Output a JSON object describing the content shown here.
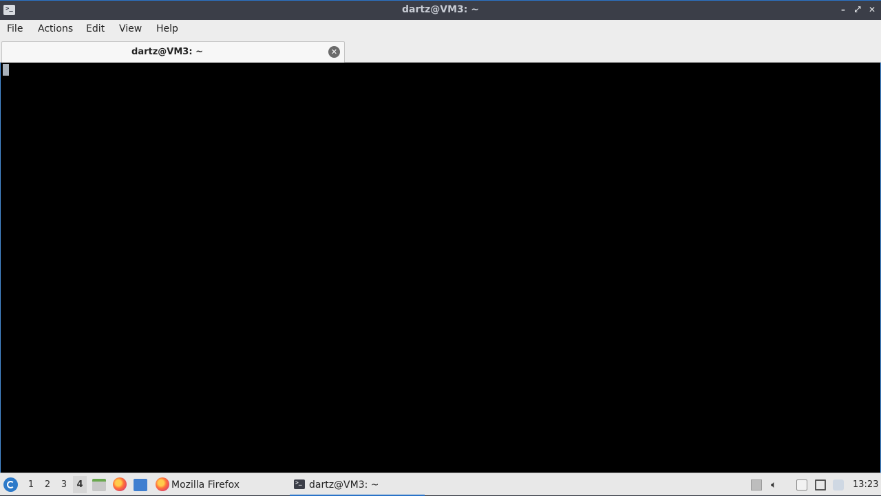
{
  "window": {
    "title": "dartz@VM3: ~",
    "icon": "terminal-icon",
    "controls": [
      "minimize-icon",
      "maximize-icon",
      "close-icon"
    ]
  },
  "menubar": {
    "items": [
      "File",
      "Actions",
      "Edit",
      "View",
      "Help"
    ]
  },
  "tabs": [
    {
      "label": "dartz@VM3: ~",
      "close_icon": "close-circle-icon"
    }
  ],
  "terminal": {
    "content": "",
    "background": "#000000",
    "cursor_color": "#a9b2bb"
  },
  "taskbar": {
    "start_icon": "lubuntu-start-icon",
    "workspaces": [
      "1",
      "2",
      "3",
      "4"
    ],
    "active_workspace": "4",
    "quicklaunch": [
      "file-manager-icon",
      "firefox-icon",
      "desktop-icon"
    ],
    "tasks": [
      {
        "label": "Mozilla Firefox",
        "icon": "firefox-icon",
        "active": false
      },
      {
        "label": "dartz@VM3: ~",
        "icon": "terminal-icon",
        "active": true
      }
    ],
    "tray": [
      "tray-arrow-icon",
      "volume-icon",
      "clipboard-icon",
      "network-icon",
      "update-notifier-icon"
    ],
    "clock": "13:23"
  },
  "colors": {
    "titlebar": "#3b3e48",
    "accent": "#2a73c8",
    "menubar": "#ededed",
    "taskbar": "#e8e8e8"
  }
}
